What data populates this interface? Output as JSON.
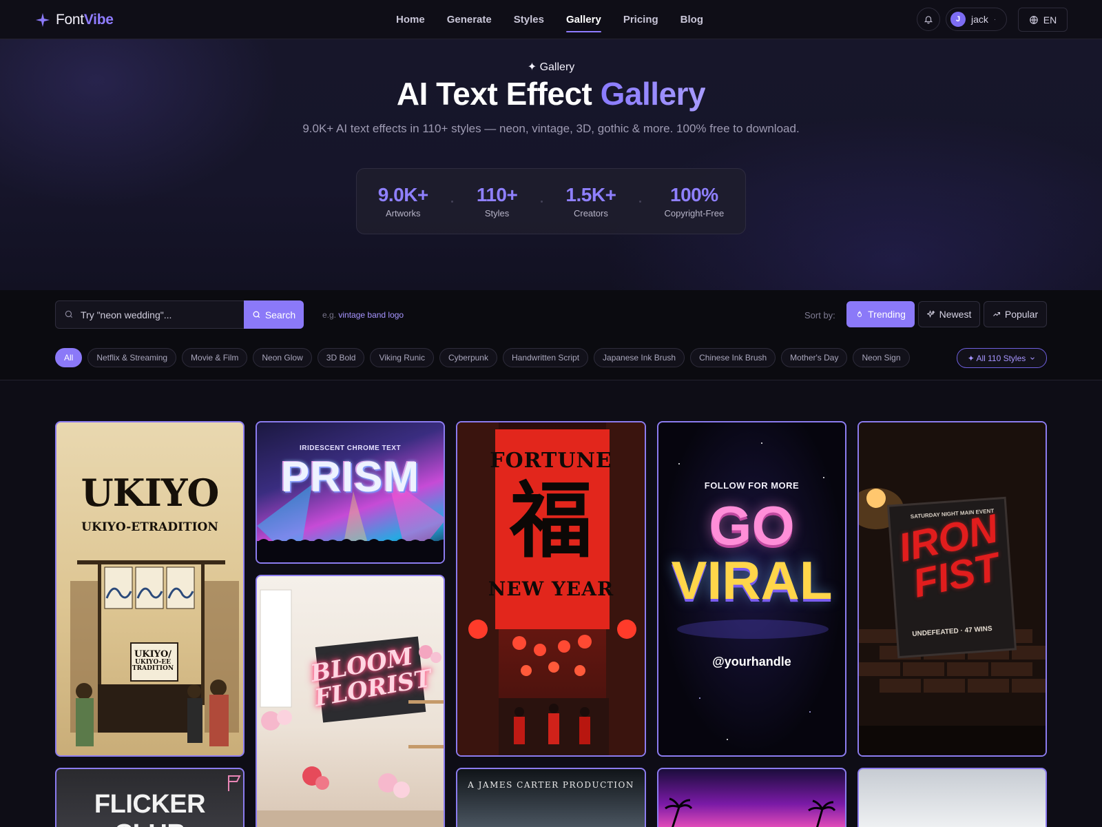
{
  "brand": {
    "name_part1": "Font",
    "name_part2": "Vibe"
  },
  "nav": {
    "links": [
      "Home",
      "Generate",
      "Styles",
      "Gallery",
      "Pricing",
      "Blog"
    ],
    "active": "Gallery",
    "user_initial": "J",
    "user_name": "jack",
    "language": "EN"
  },
  "hero": {
    "eyebrow": "✦ Gallery",
    "title_main": "AI Text Effect ",
    "title_accent": "Gallery",
    "subtitle": "9.0K+ AI text effects in 110+ styles — neon, vintage, 3D, gothic & more. 100% free to download.",
    "stats": [
      {
        "value": "9.0K+",
        "label": "Artworks"
      },
      {
        "value": "110+",
        "label": "Styles"
      },
      {
        "value": "1.5K+",
        "label": "Creators"
      },
      {
        "value": "100%",
        "label": "Copyright-Free"
      }
    ]
  },
  "search": {
    "placeholder": "Try \"neon wedding\"...",
    "button": "Search",
    "example_prefix": "e.g.",
    "example_link": "vintage band logo"
  },
  "sort": {
    "label": "Sort by:",
    "options": [
      "Trending",
      "Newest",
      "Popular"
    ],
    "active": "Trending"
  },
  "categories": {
    "chips": [
      "All",
      "Netflix & Streaming",
      "Movie & Film",
      "Neon Glow",
      "3D Bold",
      "Viking Runic",
      "Cyberpunk",
      "Handwritten Script",
      "Japanese Ink Brush",
      "Chinese Ink Brush",
      "Mother's Day",
      "Neon Sign"
    ],
    "active": "All",
    "all_styles": "✦ All 110 Styles"
  },
  "gallery": {
    "ukiyo": {
      "title": "UKIYO",
      "subtitle": "UKIYO-ETRADITION",
      "sign_line1": "UKIYO/",
      "sign_line2": "UKIYO-EE",
      "sign_line3": "TRADITION"
    },
    "prism": {
      "caption": "IRIDESCENT CHROME TEXT",
      "title": "PRISM"
    },
    "fortune": {
      "top": "FORTUNE",
      "glyph": "福",
      "bottom": "NEW YEAR"
    },
    "viral": {
      "top": "FOLLOW FOR MORE",
      "line1": "GO",
      "line2": "VIRAL",
      "handle": "@yourhandle"
    },
    "iron": {
      "event": "SATURDAY NIGHT MAIN EVENT",
      "line1": "IRON",
      "line2": "FIST",
      "footer": "UNDEFEATED · 47 WINS"
    },
    "bloom": {
      "line1": "BLOOM",
      "line2": "FLORIST"
    },
    "flicker": {
      "title": "FLICKER CLUB"
    },
    "carter": {
      "title": "A JAMES CARTER PRODUCTION"
    }
  },
  "colors": {
    "accent": "#8b79f8",
    "background": "#0e0d16",
    "stat": "#8f80ff"
  }
}
